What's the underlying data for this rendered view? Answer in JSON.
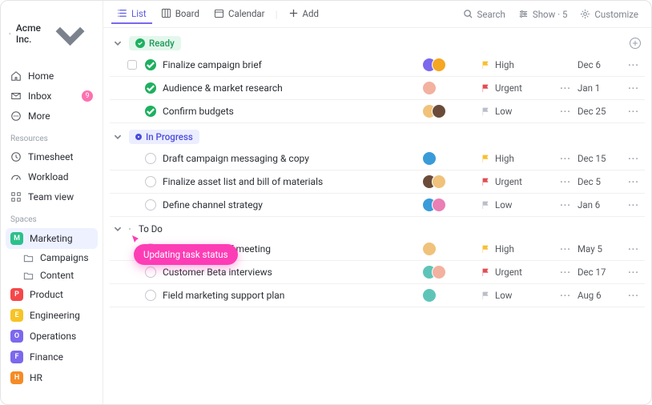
{
  "workspace": {
    "name": "Acme Inc."
  },
  "sidebar": {
    "nav": [
      {
        "label": "Home"
      },
      {
        "label": "Inbox",
        "badge": "9"
      },
      {
        "label": "More"
      }
    ],
    "sections": {
      "resources_label": "Resources",
      "resources": [
        {
          "label": "Timesheet"
        },
        {
          "label": "Workload"
        },
        {
          "label": "Team view"
        }
      ],
      "spaces_label": "Spaces",
      "spaces": [
        {
          "letter": "M",
          "label": "Marketing",
          "color": "#2cc08b",
          "active": true,
          "folders": [
            {
              "label": "Campaigns"
            },
            {
              "label": "Content"
            }
          ]
        },
        {
          "letter": "P",
          "label": "Product",
          "color": "#f5474a"
        },
        {
          "letter": "E",
          "label": "Engineering",
          "color": "#f7c325"
        },
        {
          "letter": "O",
          "label": "Operations",
          "color": "#7b68ee"
        },
        {
          "letter": "F",
          "label": "Finance",
          "color": "#7b68ee"
        },
        {
          "letter": "H",
          "label": "HR",
          "color": "#f58b25"
        }
      ]
    }
  },
  "topbar": {
    "views": [
      {
        "label": "List",
        "active": true
      },
      {
        "label": "Board"
      },
      {
        "label": "Calendar"
      }
    ],
    "add_label": "Add",
    "search_label": "Search",
    "show_label": "Show · 5",
    "customize_label": "Customize"
  },
  "tooltip_text": "Updating task status",
  "groups": [
    {
      "name": "Ready",
      "pill_bg": "#e4f7ed",
      "pill_fg": "#1f9b58",
      "dot_bg": "#1db05f",
      "dot_check": true,
      "show_plus": true,
      "tasks": [
        {
          "title": "Finalize campaign brief",
          "status": "done",
          "checkbox": true,
          "assignees": [
            "#7b68ee",
            "#f5a623"
          ],
          "prio": "High",
          "flag": "#f9be33",
          "more1": false,
          "date": "Dec 6"
        },
        {
          "title": "Audience & market research",
          "status": "done",
          "assignees": [
            "#f3b1a0"
          ],
          "prio": "Urgent",
          "flag": "#e04f54",
          "more1": true,
          "date": "Jan 1"
        },
        {
          "title": "Confirm budgets",
          "status": "done",
          "assignees": [
            "#f0c27b",
            "#6a4b3a"
          ],
          "prio": "Low",
          "flag": "#b9bec7",
          "more1": true,
          "date": "Dec 25"
        }
      ]
    },
    {
      "name": "In Progress",
      "pill_bg": "#eceeff",
      "pill_fg": "#4b4bdc",
      "dot_bg": "#ffffff",
      "dot_border": "#4b4bdc",
      "tasks": [
        {
          "title": "Draft campaign messaging & copy",
          "status": "open",
          "assignees": [
            "#3a9bd9"
          ],
          "prio": "High",
          "flag": "#f9be33",
          "more1": true,
          "date": "Dec 15"
        },
        {
          "title": "Finalize asset list and bill of materials",
          "status": "open",
          "assignees": [
            "#6a4b3a",
            "#f0c27b"
          ],
          "prio": "Urgent",
          "flag": "#e04f54",
          "more1": true,
          "date": "Dec 5"
        },
        {
          "title": "Define channel strategy",
          "status": "open",
          "assignees": [
            "#3a9bd9",
            "#e97fb4"
          ],
          "prio": "Low",
          "flag": "#b9bec7",
          "more1": true,
          "date": "Jan 6"
        }
      ]
    },
    {
      "name": "To Do",
      "plain": true,
      "tasks": [
        {
          "title": "Schedule kickoff meeting",
          "status": "open",
          "assignees": [
            "#f0c27b"
          ],
          "prio": "High",
          "flag": "#f9be33",
          "more1": true,
          "date": "May 5"
        },
        {
          "title": "Customer Beta interviews",
          "status": "open",
          "assignees": [
            "#5fc4b8",
            "#f3b1a0"
          ],
          "prio": "Urgent",
          "flag": "#e04f54",
          "more1": true,
          "date": "Dec 17"
        },
        {
          "title": "Field marketing support plan",
          "status": "open",
          "assignees": [
            "#5fc4b8"
          ],
          "prio": "Low",
          "flag": "#b9bec7",
          "more1": true,
          "date": "Aug 6"
        }
      ]
    }
  ]
}
